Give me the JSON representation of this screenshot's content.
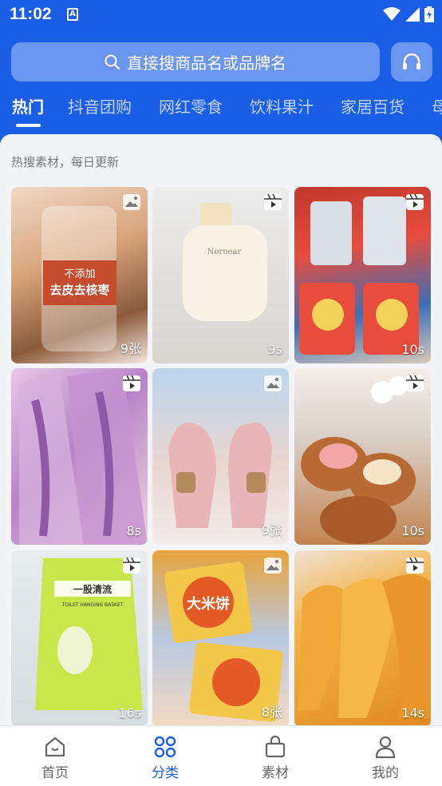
{
  "status": {
    "time": "11:02",
    "notif_glyph": "A"
  },
  "search": {
    "placeholder": "直接搜商品名或品牌名"
  },
  "tabs": [
    {
      "label": "热门",
      "active": true
    },
    {
      "label": "抖音团购"
    },
    {
      "label": "网红零食"
    },
    {
      "label": "饮料果汁"
    },
    {
      "label": "家居百货"
    },
    {
      "label": "母"
    }
  ],
  "hint": "热搜素材，每日更新",
  "cards": [
    {
      "meta": "9张",
      "type": "image-icon",
      "overlay_text": "不添加\n去皮去核枣"
    },
    {
      "meta": "9s",
      "type": "video-icon",
      "overlay_text": "Nornear"
    },
    {
      "meta": "10s",
      "type": "video-icon",
      "overlay_text": ""
    },
    {
      "meta": "8s",
      "type": "video-icon",
      "overlay_text": ""
    },
    {
      "meta": "9张",
      "type": "image-icon",
      "overlay_text": ""
    },
    {
      "meta": "10s",
      "type": "video-icon",
      "overlay_text": ""
    },
    {
      "meta": "16s",
      "type": "video-icon",
      "overlay_text": "一股清流\nTOILET HANGING BASKET"
    },
    {
      "meta": "8张",
      "type": "image-icon",
      "overlay_text": "大米饼"
    },
    {
      "meta": "14s",
      "type": "video-icon",
      "overlay_text": ""
    }
  ],
  "bottom_nav": [
    {
      "label": "首页",
      "icon": "home-icon"
    },
    {
      "label": "分类",
      "icon": "category-icon",
      "active": true
    },
    {
      "label": "素材",
      "icon": "bag-icon"
    },
    {
      "label": "我的",
      "icon": "user-icon"
    }
  ],
  "colors": {
    "brand": "#1a5ee6",
    "search_bg": "#6b96f0"
  }
}
